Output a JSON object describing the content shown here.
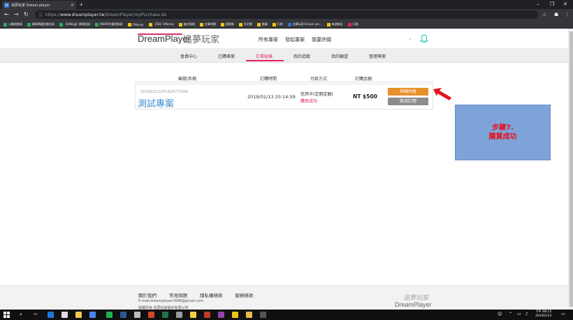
{
  "browser": {
    "tab_title": "追夢玩家 Dream player",
    "tab_favicon": "DP",
    "url_prefix": "https://",
    "url_host": "www.dreamplayer.tw",
    "url_path": "/DreamPlayer/myPurchase.do",
    "bookmarks": [
      {
        "label": "公職遊戲表",
        "color": "#34a853"
      },
      {
        "label": "國軍寶藏金融包表",
        "color": "#34a853"
      },
      {
        "label": "【LINE@】夢想紀錄",
        "color": "#34a853"
      },
      {
        "label": "[NEW]作業提報表",
        "color": "#34a853"
      },
      {
        "label": "CMoney",
        "color": "#f4c20d"
      },
      {
        "label": "【FB】CMoney",
        "color": "#f4c20d"
      },
      {
        "label": "後台管理",
        "color": "#f4c20d"
      },
      {
        "label": "文章相關",
        "color": "#f4c20d"
      },
      {
        "label": "理財類",
        "color": "#f4c20d"
      },
      {
        "label": "丹尼爾",
        "color": "#f4c20d"
      },
      {
        "label": "動圖",
        "color": "#f4c20d"
      },
      {
        "label": "行銷",
        "color": "#f4c20d"
      },
      {
        "label": "追夢玩家 Dream pla...",
        "color": "#2d6fd0"
      },
      {
        "label": "每週報告",
        "color": "#f4c20d"
      },
      {
        "label": "行銷",
        "color": "#e0245e"
      }
    ]
  },
  "site": {
    "logo_en": "DreamPlayer",
    "logo_zh": "追夢玩家",
    "main_nav": [
      "所有專案",
      "發起專案",
      "我要許願"
    ],
    "sub_nav": [
      "會員中心",
      "已購專案",
      "訂單紀錄",
      "我的追蹤",
      "我的願望",
      "管理專案"
    ],
    "active_sub_nav": "訂單紀錄"
  },
  "orders": {
    "headers": [
      "編號/名稱",
      "訂購時間",
      "付款方式",
      "訂購金額"
    ],
    "rows": [
      {
        "order_no": "201902132014207720I6",
        "project_name": "測試專案",
        "order_time": "2019/02/13 20:14:59",
        "payment_method": "信用卡(定期定額)",
        "payment_status": "購買成功",
        "amount": "NT $500",
        "detail_label": "詳細內容",
        "cancel_label": "取消訂閱"
      }
    ]
  },
  "annotation": {
    "line1": "步驟7.",
    "line2": "購買成功"
  },
  "footer": {
    "links": [
      "關於我們",
      "常見問題",
      "隱私權條款",
      "服務條款"
    ],
    "email": "E-mail:dreamplayer1688@gmail.com",
    "copyright": "版權所有 追夢玩家股份有限公司",
    "logo_zh": "追夢玩家",
    "logo_en": "DreamPlayer"
  },
  "taskbar": {
    "time": "下午 08:15",
    "date": "2019/2/13"
  },
  "colors": {
    "accent": "#e0245e",
    "detail_button": "#e8902a",
    "cancel_button": "#8c8c8c",
    "project_title": "#3a8fd6",
    "annotation_bg": "#7da3d9",
    "annotation_text": "#e8121a"
  }
}
